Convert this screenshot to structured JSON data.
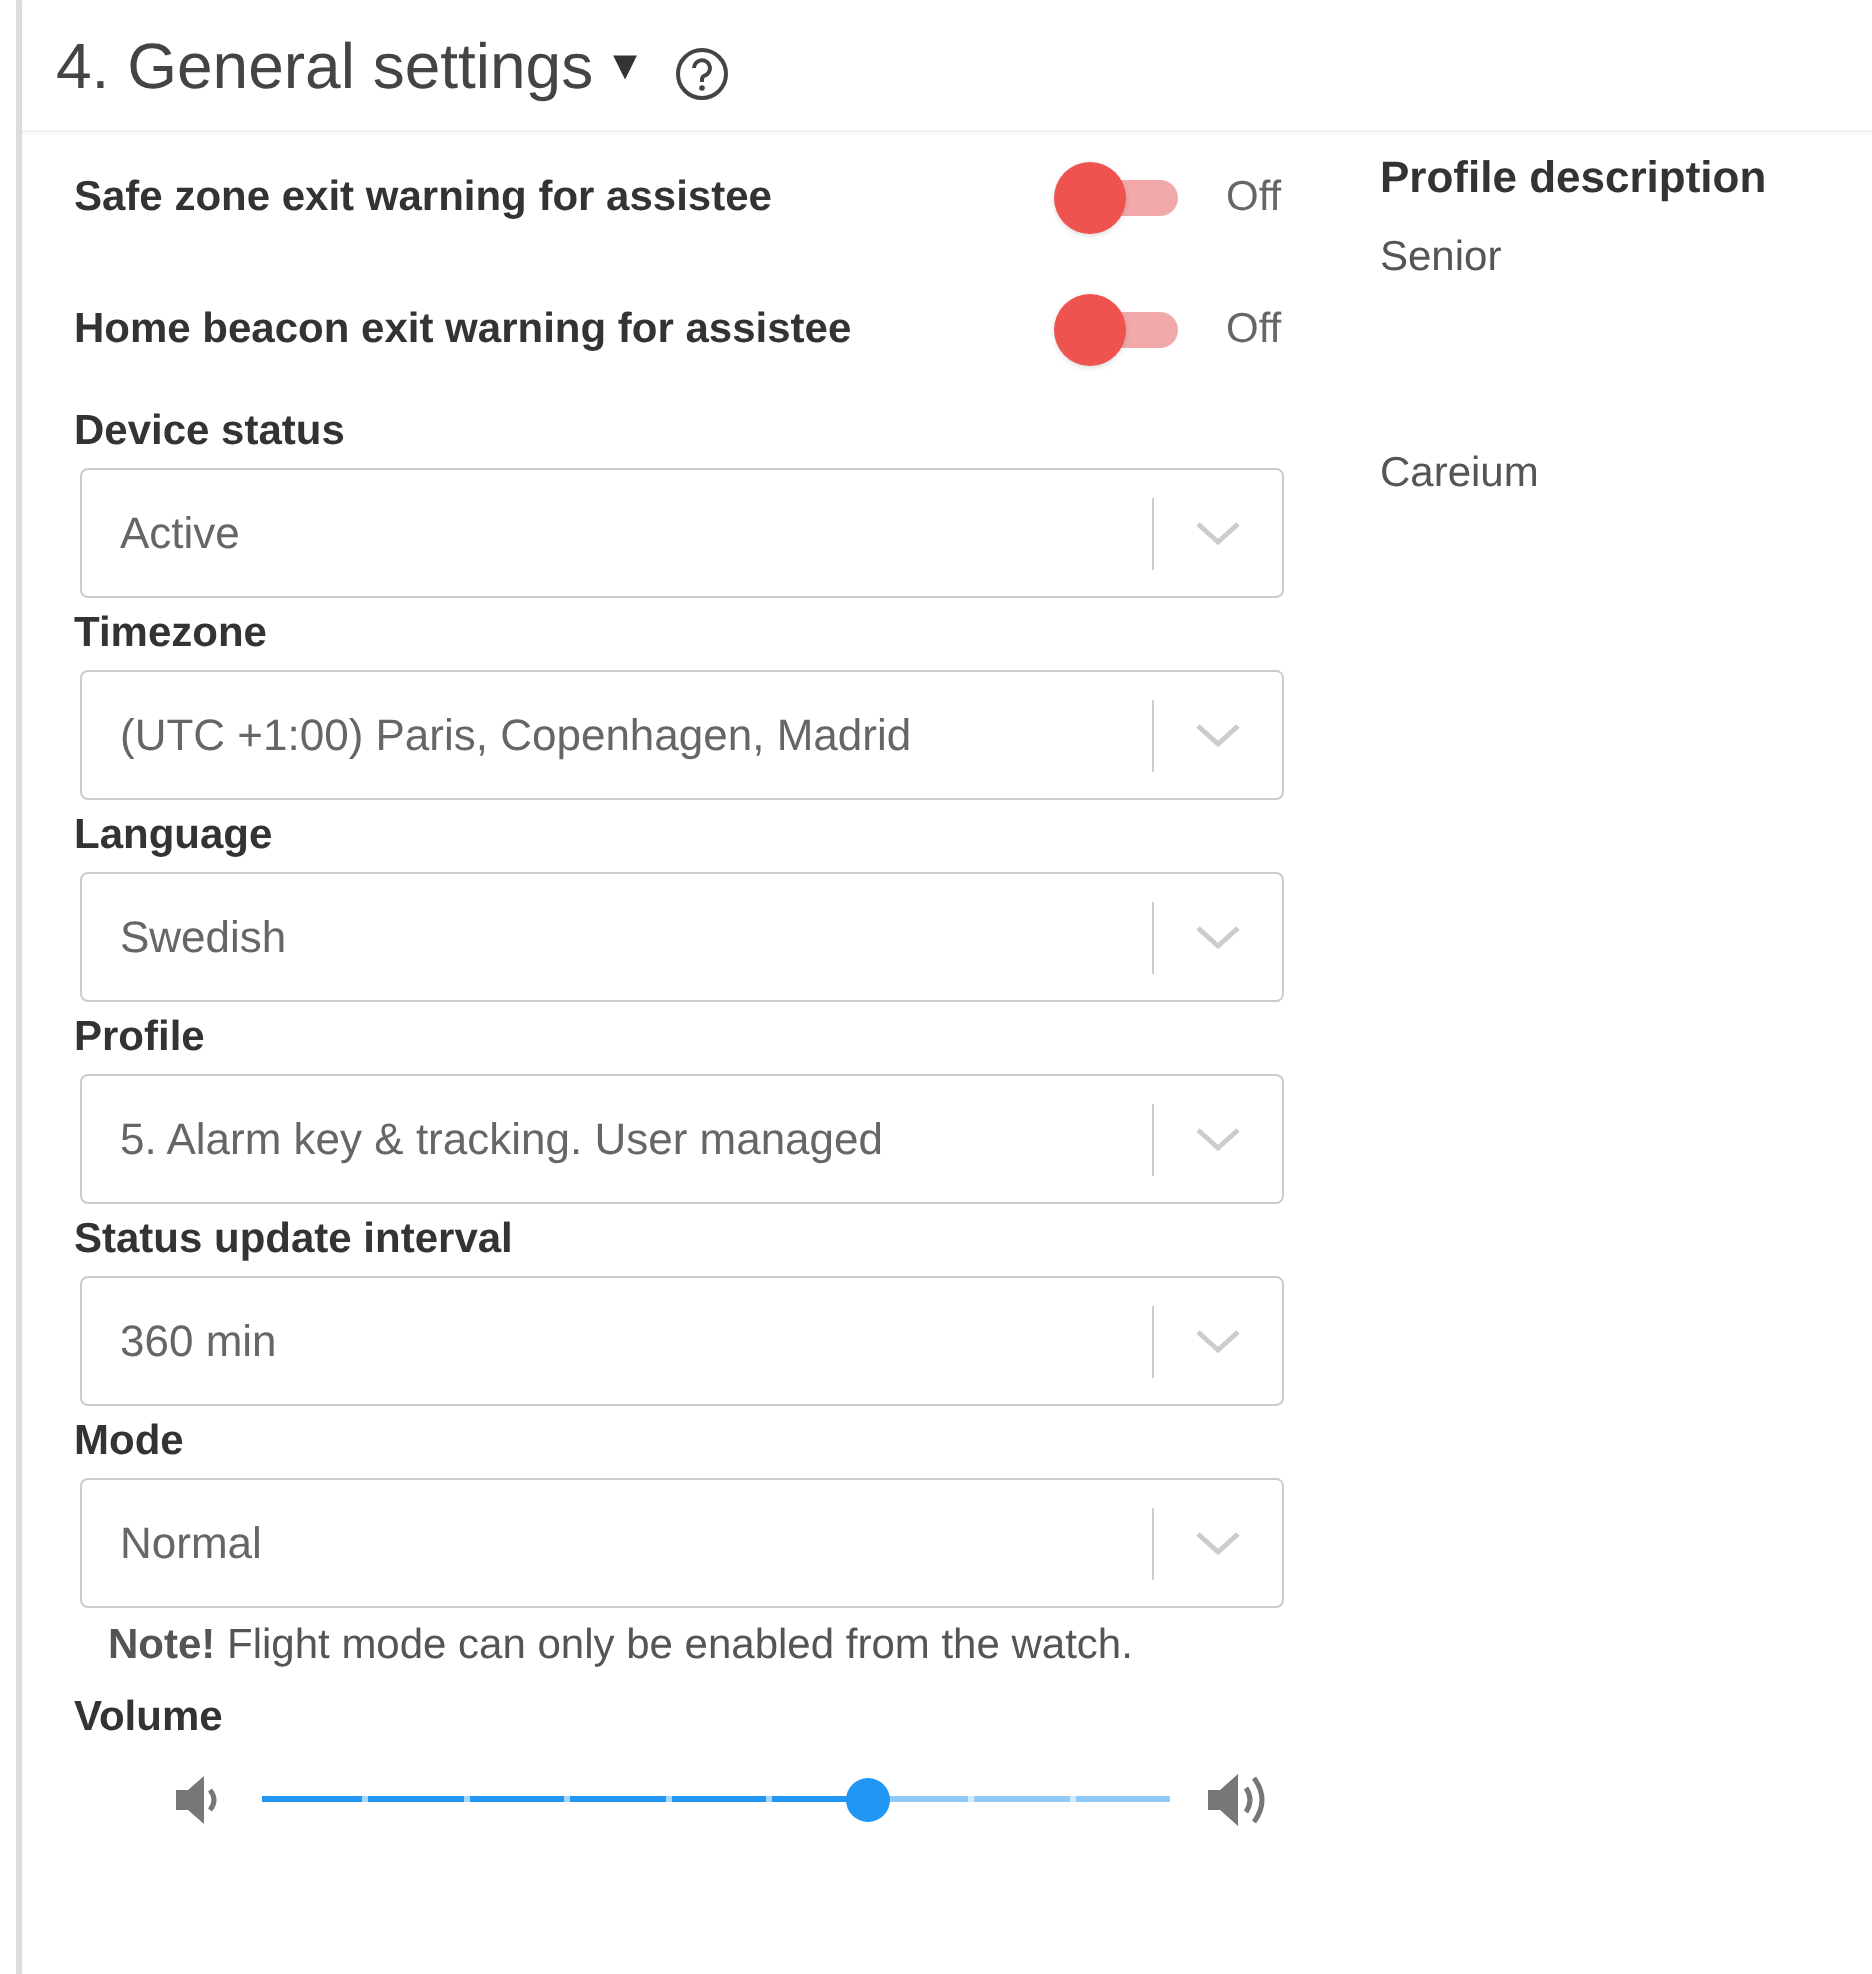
{
  "header": {
    "title": "4. General settings",
    "menu_glyph": "▾"
  },
  "toggles": [
    {
      "label": "Safe zone exit warning for assistee",
      "on": false,
      "state_text": "Off"
    },
    {
      "label": "Home beacon exit warning for assistee",
      "on": false,
      "state_text": "Off"
    }
  ],
  "selects": [
    {
      "label": "Device status",
      "value": "Active"
    },
    {
      "label": "Timezone",
      "value": "(UTC +1:00) Paris, Copenhagen, Madrid"
    },
    {
      "label": "Language",
      "value": "Swedish"
    },
    {
      "label": "Profile",
      "value": "5. Alarm key & tracking. User managed"
    },
    {
      "label": "Status update interval",
      "value": "360 min"
    },
    {
      "label": "Mode",
      "value": "Normal"
    }
  ],
  "note": "**Note!** Flight mode can only be enabled from the watch.",
  "volume": {
    "label": "Volume",
    "level": 0.667
  },
  "profile_description": {
    "label": "Profile description",
    "lines": [
      "Senior",
      "Careium"
    ]
  }
}
